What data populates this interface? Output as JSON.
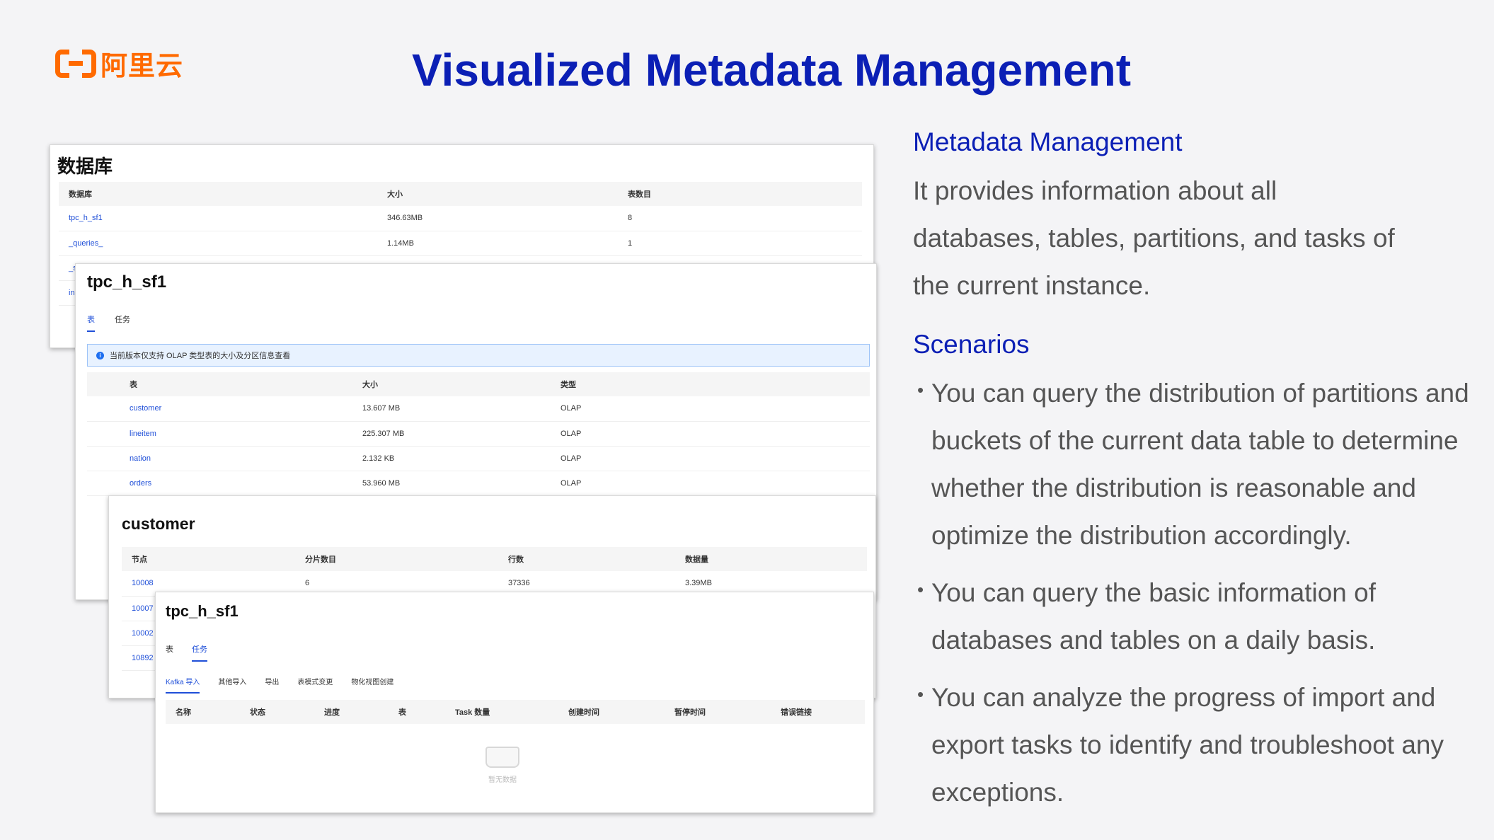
{
  "logo": {
    "text": "阿里云"
  },
  "title": "Visualized Metadata Management",
  "db_panel": {
    "title": "数据库",
    "columns": [
      "数据库",
      "大小",
      "表数目"
    ],
    "rows": [
      [
        "tpc_h_sf1",
        "346.63MB",
        "8"
      ],
      [
        "_queries_",
        "1.14MB",
        "1"
      ],
      [
        "_s",
        "",
        ""
      ],
      [
        "in",
        "",
        ""
      ]
    ]
  },
  "tables_panel": {
    "title": "tpc_h_sf1",
    "tabs": [
      "表",
      "任务"
    ],
    "active_tab": "表",
    "notice": "当前版本仅支持 OLAP 类型表的大小及分区信息查看",
    "columns": [
      "表",
      "大小",
      "类型"
    ],
    "rows": [
      [
        "customer",
        "13.607 MB",
        "OLAP"
      ],
      [
        "lineitem",
        "225.307 MB",
        "OLAP"
      ],
      [
        "nation",
        "2.132 KB",
        "OLAP"
      ],
      [
        "orders",
        "53.960 MB",
        "OLAP"
      ]
    ]
  },
  "customer_panel": {
    "title": "customer",
    "columns": [
      "节点",
      "分片数目",
      "行数",
      "数据量"
    ],
    "rows": [
      [
        "10008",
        "6",
        "37336",
        "3.39MB"
      ],
      [
        "10007",
        "",
        "",
        ""
      ],
      [
        "10002",
        "",
        "",
        ""
      ],
      [
        "10892",
        "",
        "",
        ""
      ]
    ]
  },
  "tasks_panel": {
    "title": "tpc_h_sf1",
    "tabs": [
      "表",
      "任务"
    ],
    "active_tab": "任务",
    "subtabs": [
      "Kafka 导入",
      "其他导入",
      "导出",
      "表模式变更",
      "物化视图创建"
    ],
    "active_subtab": "Kafka 导入",
    "columns": [
      "名称",
      "状态",
      "进度",
      "表",
      "Task 数量",
      "创建时间",
      "暂停时间",
      "错误链接"
    ],
    "empty_text": "暂无数据"
  },
  "right": {
    "heading1": "Metadata Management",
    "para_lines": [
      "It provides information about all",
      "databases, tables, partitions, and tasks of",
      "the current instance."
    ],
    "heading2": "Scenarios",
    "bullets": [
      [
        "You can query the distribution of partitions and",
        "buckets of the current data table to determine",
        "whether the distribution is reasonable and",
        "optimize the distribution accordingly."
      ],
      [
        "You can query the basic information of",
        "databases and tables on a daily basis."
      ],
      [
        "You can analyze the progress of import and",
        "export tasks to identify and troubleshoot any",
        "exceptions."
      ]
    ]
  },
  "colors": {
    "title": "#0b1fb5",
    "logo": "#ff6a00",
    "link": "#1f4fd8"
  }
}
